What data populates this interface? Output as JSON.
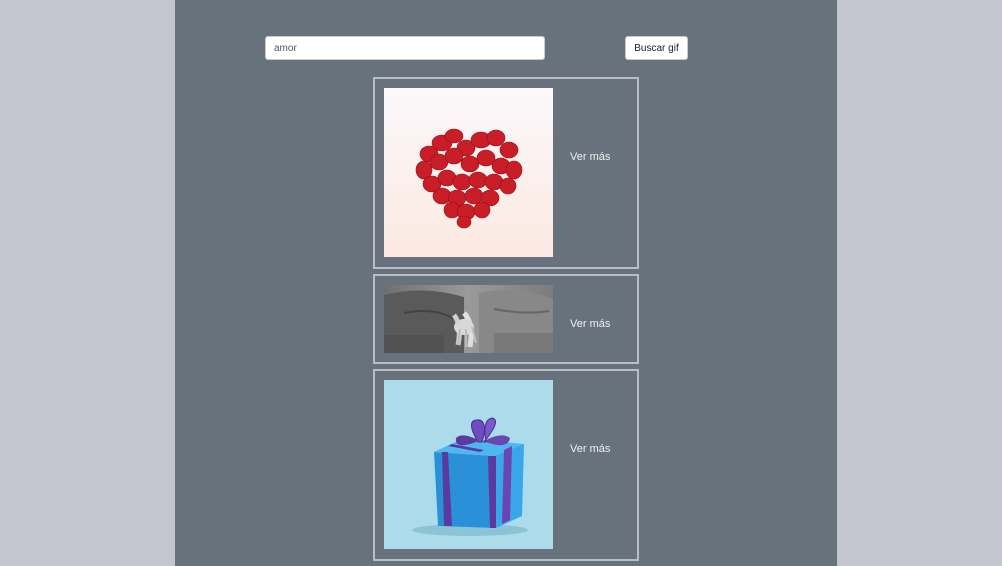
{
  "search": {
    "value": "amor",
    "button_label": "Buscar gif"
  },
  "results": [
    {
      "image": "rose-petal-heart",
      "link_label": "Ver más"
    },
    {
      "image": "holding-hands-bw",
      "link_label": "Ver más"
    },
    {
      "image": "blue-gift-box",
      "link_label": "Ver más"
    }
  ],
  "colors": {
    "page_background": "#c3c6ce",
    "panel_background": "#67727c",
    "card_border": "#b9bdc4",
    "link_text": "#eef0f2"
  }
}
